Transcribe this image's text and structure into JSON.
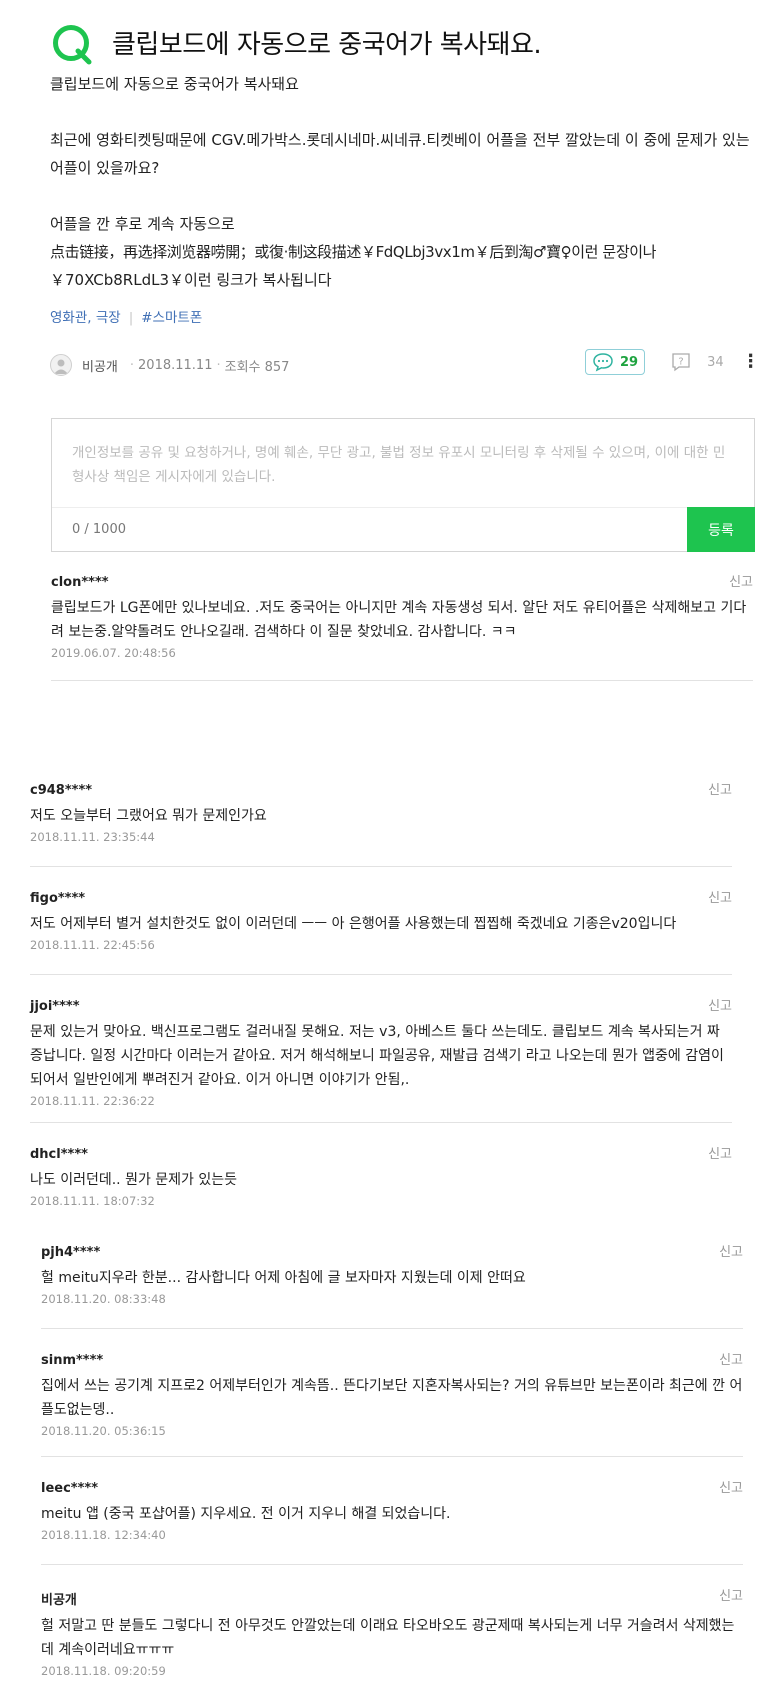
{
  "question": {
    "title": "클립보드에 자동으로 중국어가 복사돼요.",
    "body_lines": [
      "클립보드에 자동으로 중국어가 복사돼요",
      "",
      "최근에 영화티켓팅때문에 CGV.메가박스.롯데시네마.씨네큐.티켓베이 어플을 전부 깔았는데 이 중에 문제가 있는 어플이 있을까요?",
      "",
      "어플을 깐 후로 계속 자동으로",
      "点击链接，再选择浏览器唠開；或復·制这段描述￥FdQLbj3vx1m￥后到淘♂寶♀이런 문장이나",
      "￥70XCb8RLdL3￥이런 링크가 복사됩니다"
    ],
    "tags": [
      "영화관, 극장",
      "#스마트폰"
    ],
    "author": "비공개",
    "date": "2018.11.11",
    "views": "조회수 857",
    "comment_count": "29",
    "answer_count": "34"
  },
  "editor": {
    "placeholder": "개인정보를 공유 및 요청하거나, 명예 훼손, 무단 광고, 불법 정보 유포시 모니터링 후 삭제될 수 있으며, 이에 대한 민형사상 책임은 게시자에게 있습니다.",
    "counter": "0 / 1000",
    "submit_label": "등록"
  },
  "report_label": "신고",
  "comments": [
    {
      "author": "clon****",
      "text": "클립보드가 LG폰에만 있나보네요. .저도 중국어는 아니지만 계속 자동생성 되서. 알단 저도 유티어플은 삭제해보고 기다려 보는중.알약돌려도 안나오길래. 검색하다 이 질문 찾았네요. 감사합니다. ㅋㅋ",
      "date": "2019.06.07. 20:48:56"
    },
    {
      "author": "c948****",
      "text": "저도 오늘부터 그랬어요 뭐가 문제인가요",
      "date": "2018.11.11. 23:35:44"
    },
    {
      "author": "figo****",
      "text": "저도 어제부터 별거 설치한것도 없이 이러던데 ㅡㅡ 아 은행어플 사용했는데 찝찝해 죽겠네요 기종은v20입니다",
      "date": "2018.11.11. 22:45:56"
    },
    {
      "author": "jjoi****",
      "text": "문제 있는거 맞아요. 백신프로그램도 걸러내질 못해요. 저는 v3, 아베스트 둘다 쓰는데도. 클립보드 계속 복사되는거 짜증납니다. 일정 시간마다 이러는거 같아요. 저거 해석해보니 파일공유, 재발급 검색기 라고 나오는데 뭔가 앱중에 감염이 되어서 일반인에게 뿌려진거 같아요. 이거 아니면 이야기가 안됨,.",
      "date": "2018.11.11. 22:36:22"
    },
    {
      "author": "dhcl****",
      "text": "나도 이러던데.. 뭔가 문제가 있는듯",
      "date": "2018.11.11. 18:07:32"
    },
    {
      "author": "pjh4****",
      "text": "헐 meitu지우라 한분... 감사합니다 어제 아침에 글 보자마자 지웠는데 이제 안떠요",
      "date": "2018.11.20. 08:33:48"
    },
    {
      "author": "sinm****",
      "text": "집에서 쓰는 공기계 지프로2 어제부터인가 계속뜸.. 뜬다기보단 지혼자복사되는? 거의 유튜브만 보는폰이라 최근에 깐 어플도없는뎅..",
      "date": "2018.11.20. 05:36:15"
    },
    {
      "author": "leec****",
      "text": "meitu 앱 (중국 포샵어플) 지우세요. 전 이거 지우니 해결 되었습니다.",
      "date": "2018.11.18. 12:34:40"
    },
    {
      "author": "비공개",
      "text": "헐 저말고 딴 분들도 그렇다니 전 아무것도 안깔았는데 이래요 타오바오도 광군제때 복사되는게 너무 거슬려서 삭제했는데 계속이러네요ㅠㅠㅠ",
      "date": "2018.11.18. 09:20:59"
    }
  ],
  "colors": {
    "accent": "#1ec44f",
    "tag": "#3f6fb5",
    "comment_count": "#1fa340"
  }
}
